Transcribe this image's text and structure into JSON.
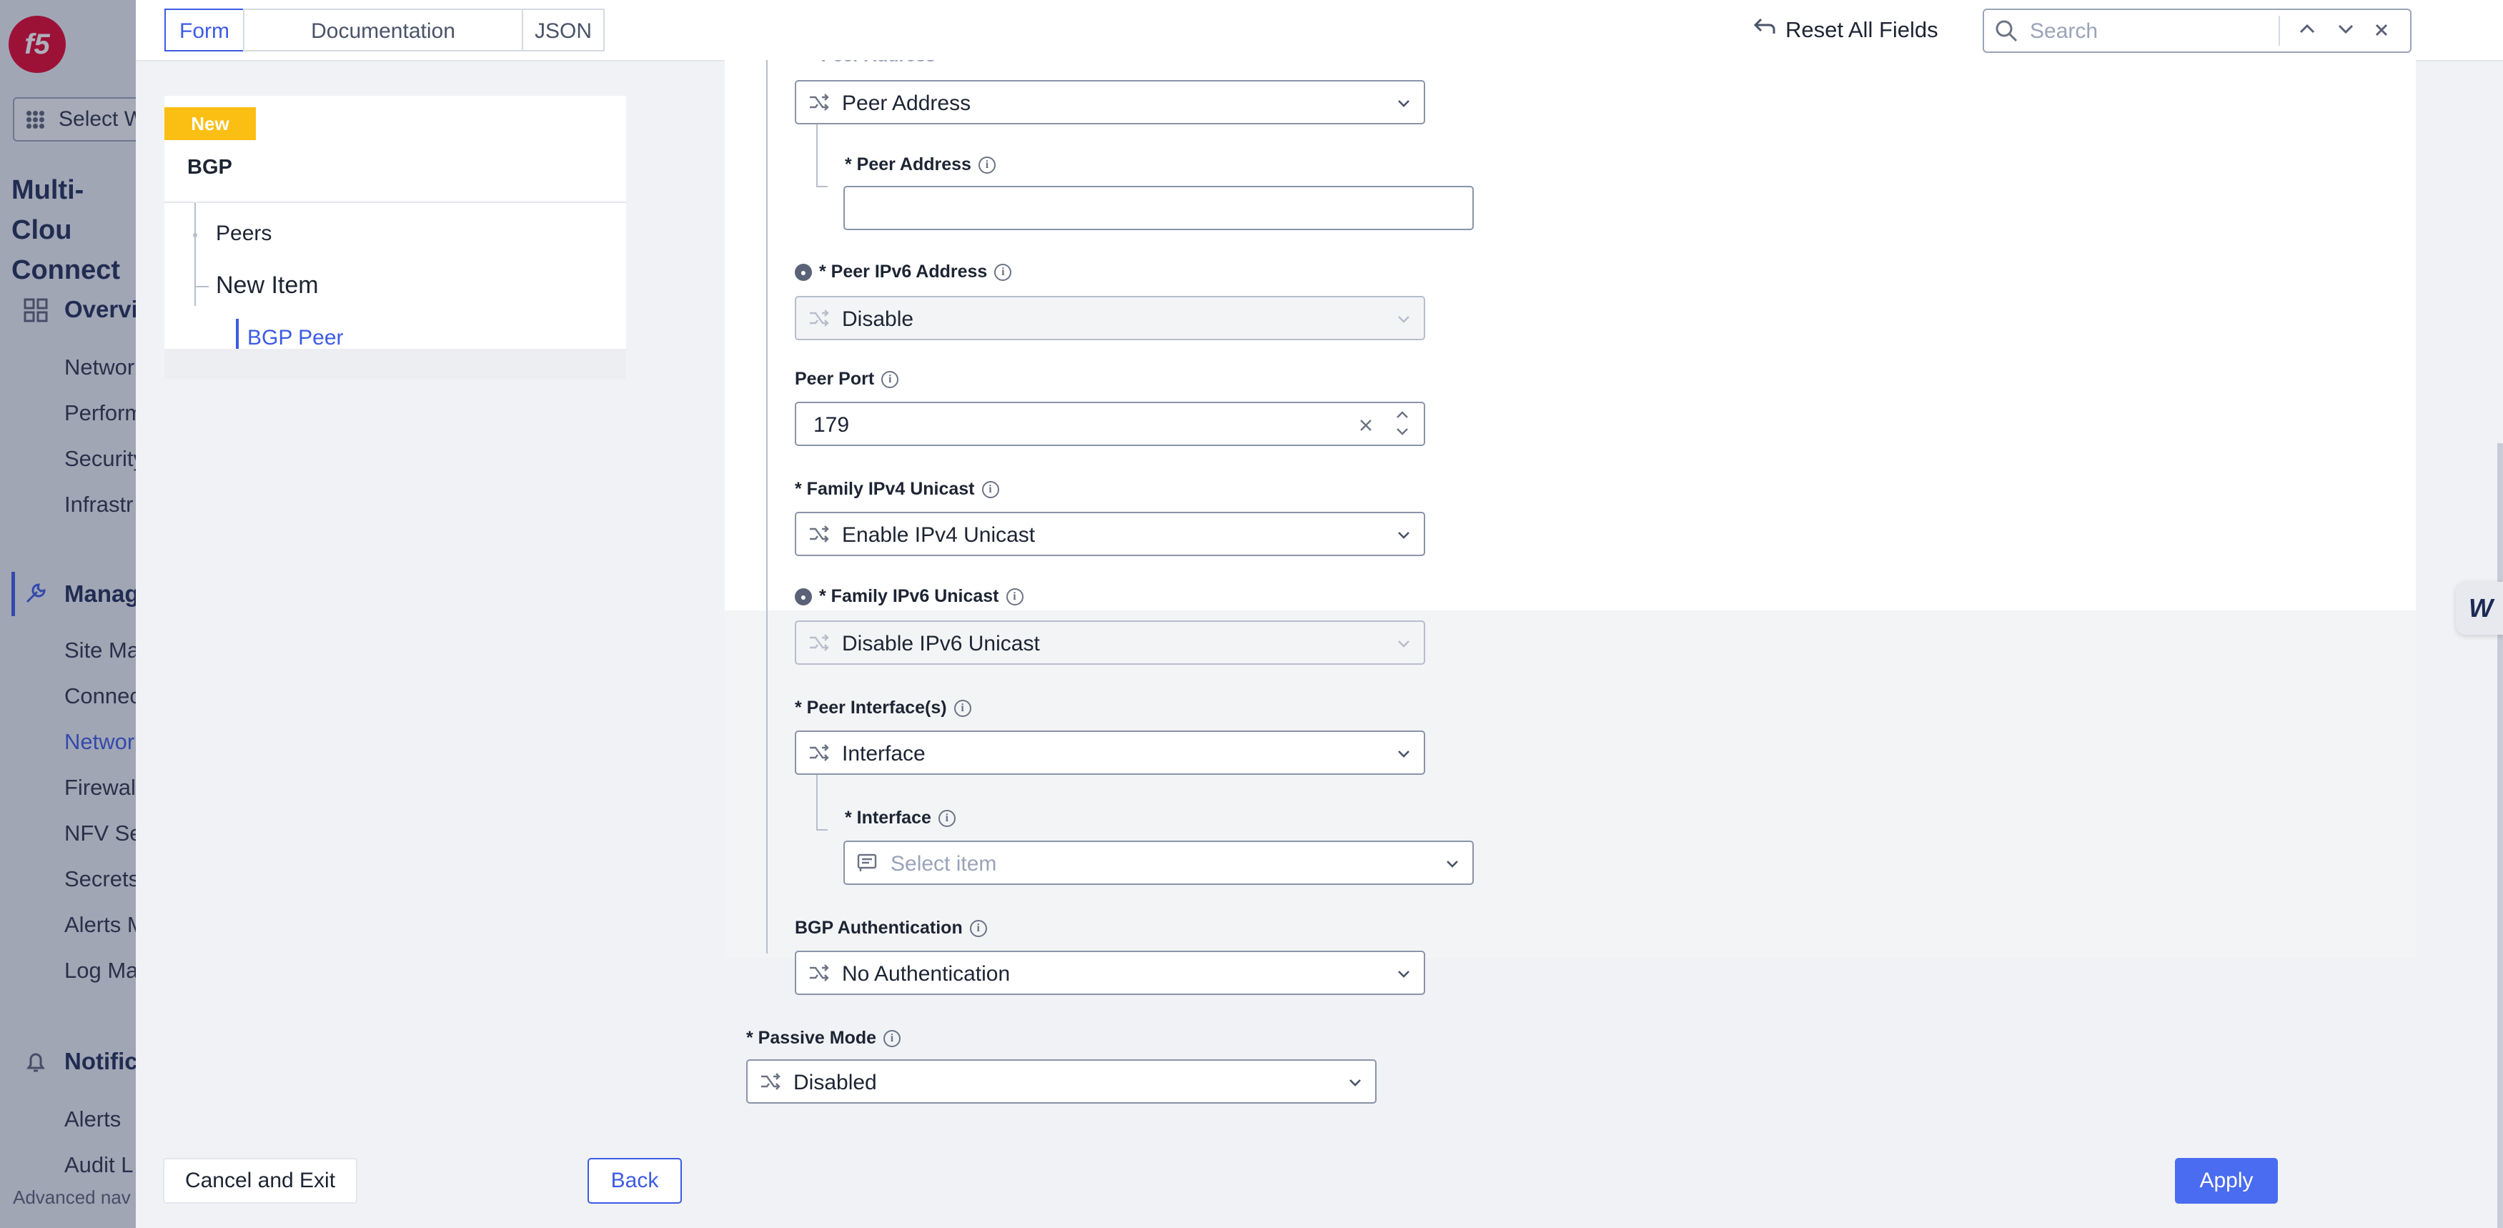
{
  "background_nav": {
    "select_workspace": "Select W",
    "app_title_line1": "Multi-Clou",
    "app_title_line2": "Connect",
    "sections": [
      {
        "label": "Overvi",
        "icon": "grid-icon"
      },
      {
        "label": "Manag",
        "icon": "wrench-icon"
      },
      {
        "label": "Notific",
        "icon": "bell-icon"
      }
    ],
    "items_overview": [
      "Networ",
      "Perform",
      "Security",
      "Infrastr"
    ],
    "items_manage": [
      "Site Ma",
      "Connec",
      "Networ",
      "Firewall",
      "NFV Se",
      "Secrets",
      "Alerts M",
      "Log Ma"
    ],
    "items_notifications": [
      "Alerts",
      "Audit L"
    ],
    "advanced_nav": "Advanced nav"
  },
  "tabs": [
    {
      "label": "Form",
      "active": true
    },
    {
      "label": "Documentation",
      "active": false
    },
    {
      "label": "JSON",
      "active": false
    }
  ],
  "toolbar": {
    "reset_label": "Reset All Fields",
    "search_placeholder": "Search"
  },
  "tree": {
    "badge": "New",
    "root": "BGP",
    "peers": "Peers",
    "new_item": "New Item",
    "bgp_peer": "BGP Peer"
  },
  "form": {
    "peer_address_choice_label": "* Peer Address",
    "peer_address_choice_value": "Peer Address",
    "peer_address_label": "* Peer Address",
    "peer_address_value": "",
    "peer_ipv6_label": "* Peer IPv6 Address",
    "peer_ipv6_value": "Disable",
    "peer_port_label": "Peer Port",
    "peer_port_value": "179",
    "family_ipv4_label": "* Family IPv4 Unicast",
    "family_ipv4_value": "Enable IPv4 Unicast",
    "family_ipv6_label": "* Family IPv6 Unicast",
    "family_ipv6_value": "Disable IPv6 Unicast",
    "peer_interfaces_label": "* Peer Interface(s)",
    "peer_interfaces_value": "Interface",
    "interface_label": "* Interface",
    "interface_placeholder": "Select item",
    "bgp_auth_label": "BGP Authentication",
    "bgp_auth_value": "No Authentication",
    "passive_mode_label": "* Passive Mode",
    "passive_mode_value": "Disabled"
  },
  "footer": {
    "cancel_label": "Cancel and Exit",
    "back_label": "Back",
    "apply_label": "Apply"
  },
  "colors": {
    "accent": "#3c5be6",
    "apply": "#4a6cf0",
    "badge": "#fbbf14",
    "brand": "#e4002b"
  }
}
